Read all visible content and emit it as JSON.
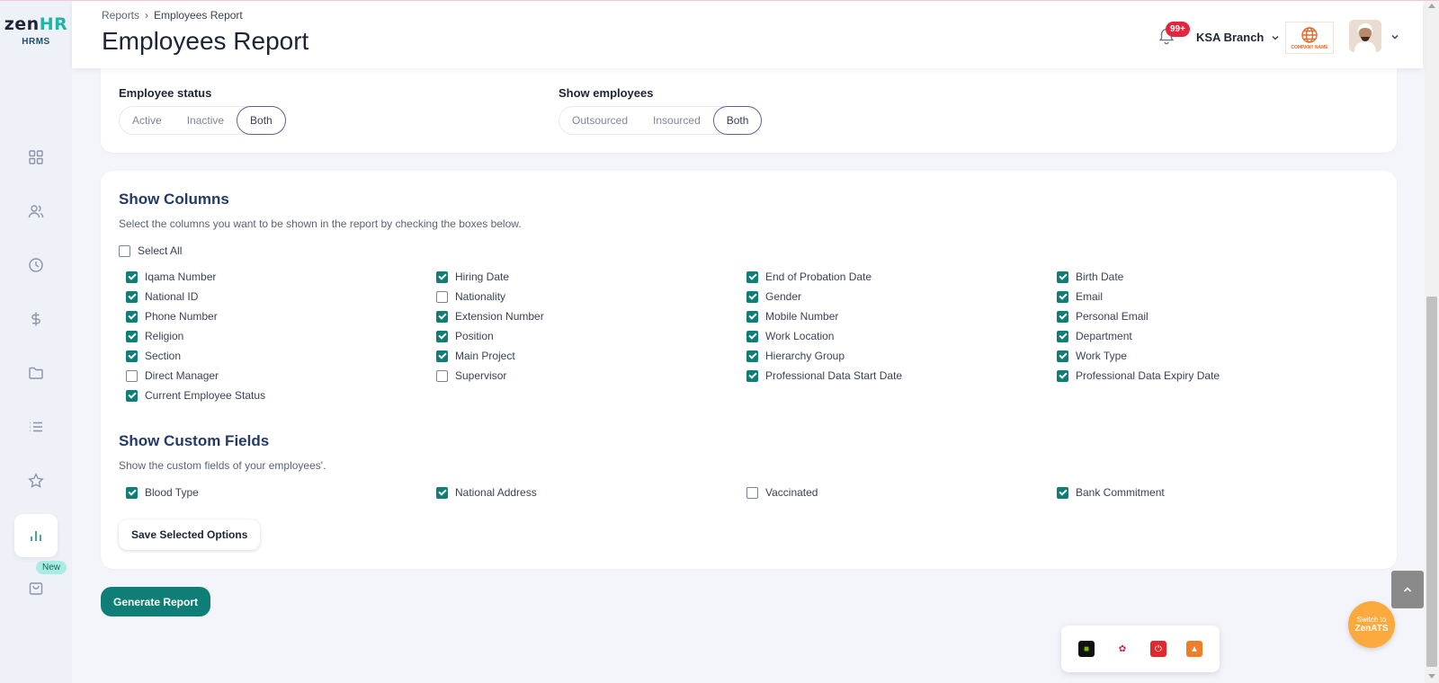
{
  "brand": {
    "logo_a": "zen",
    "logo_b": "HR",
    "sub": "HRMS"
  },
  "sidebar": {
    "items": [
      {
        "icon": "dashboard-grid-icon"
      },
      {
        "icon": "people-icon"
      },
      {
        "icon": "clock-icon"
      },
      {
        "icon": "dollar-icon"
      },
      {
        "icon": "folder-icon"
      },
      {
        "icon": "list-icon"
      },
      {
        "icon": "star-icon"
      },
      {
        "icon": "bar-chart-icon",
        "active": true
      },
      {
        "icon": "shopping-bag-icon"
      }
    ],
    "new_badge": "New"
  },
  "header": {
    "breadcrumb_root": "Reports",
    "breadcrumb_sep": "›",
    "breadcrumb_current": "Employees Report",
    "title": "Employees Report",
    "notifications": "99+",
    "branch": "KSA Branch",
    "company_logo_text": "COMPANY NAME"
  },
  "filters": {
    "employee_status": {
      "label": "Employee status",
      "options": [
        "Active",
        "Inactive",
        "Both"
      ],
      "selected": "Both"
    },
    "show_employees": {
      "label": "Show employees",
      "options": [
        "Outsourced",
        "Insourced",
        "Both"
      ],
      "selected": "Both"
    }
  },
  "columns": {
    "title": "Show Columns",
    "description": "Select the columns you want to be shown in the report by checking the boxes below.",
    "select_all": {
      "label": "Select All",
      "checked": false
    },
    "items": [
      {
        "label": "Iqama Number",
        "checked": true
      },
      {
        "label": "Hiring Date",
        "checked": true
      },
      {
        "label": "End of Probation Date",
        "checked": true
      },
      {
        "label": "Birth Date",
        "checked": true
      },
      {
        "label": "National ID",
        "checked": true
      },
      {
        "label": "Nationality",
        "checked": false
      },
      {
        "label": "Gender",
        "checked": true
      },
      {
        "label": "Email",
        "checked": true
      },
      {
        "label": "Phone Number",
        "checked": true
      },
      {
        "label": "Extension Number",
        "checked": true
      },
      {
        "label": "Mobile Number",
        "checked": true
      },
      {
        "label": "Personal Email",
        "checked": true
      },
      {
        "label": "Religion",
        "checked": true
      },
      {
        "label": "Position",
        "checked": true
      },
      {
        "label": "Work Location",
        "checked": true
      },
      {
        "label": "Department",
        "checked": true
      },
      {
        "label": "Section",
        "checked": true
      },
      {
        "label": "Main Project",
        "checked": true
      },
      {
        "label": "Hierarchy Group",
        "checked": true
      },
      {
        "label": "Work Type",
        "checked": true
      },
      {
        "label": "Direct Manager",
        "checked": false
      },
      {
        "label": "Supervisor",
        "checked": false
      },
      {
        "label": "Professional Data Start Date",
        "checked": true
      },
      {
        "label": "Professional Data Expiry Date",
        "checked": true
      },
      {
        "label": "Current Employee Status",
        "checked": true
      }
    ]
  },
  "custom_fields": {
    "title": "Show Custom Fields",
    "description": "Show the custom fields of your employees'.",
    "items": [
      {
        "label": "Blood Type",
        "checked": true
      },
      {
        "label": "National Address",
        "checked": true
      },
      {
        "label": "Vaccinated",
        "checked": false
      },
      {
        "label": "Bank Commitment",
        "checked": true
      }
    ]
  },
  "buttons": {
    "save": "Save Selected Options",
    "generate": "Generate Report"
  },
  "switch": {
    "line1": "Switch to",
    "line2": "ZenATS"
  },
  "dock": [
    {
      "icon": "nvidia-icon",
      "color": "#111111"
    },
    {
      "icon": "raspberry-icon",
      "color": "#ffffff"
    },
    {
      "icon": "power-app-icon",
      "color": "#e0282d"
    },
    {
      "icon": "orange-app-icon",
      "color": "#ef7d2a"
    }
  ]
}
